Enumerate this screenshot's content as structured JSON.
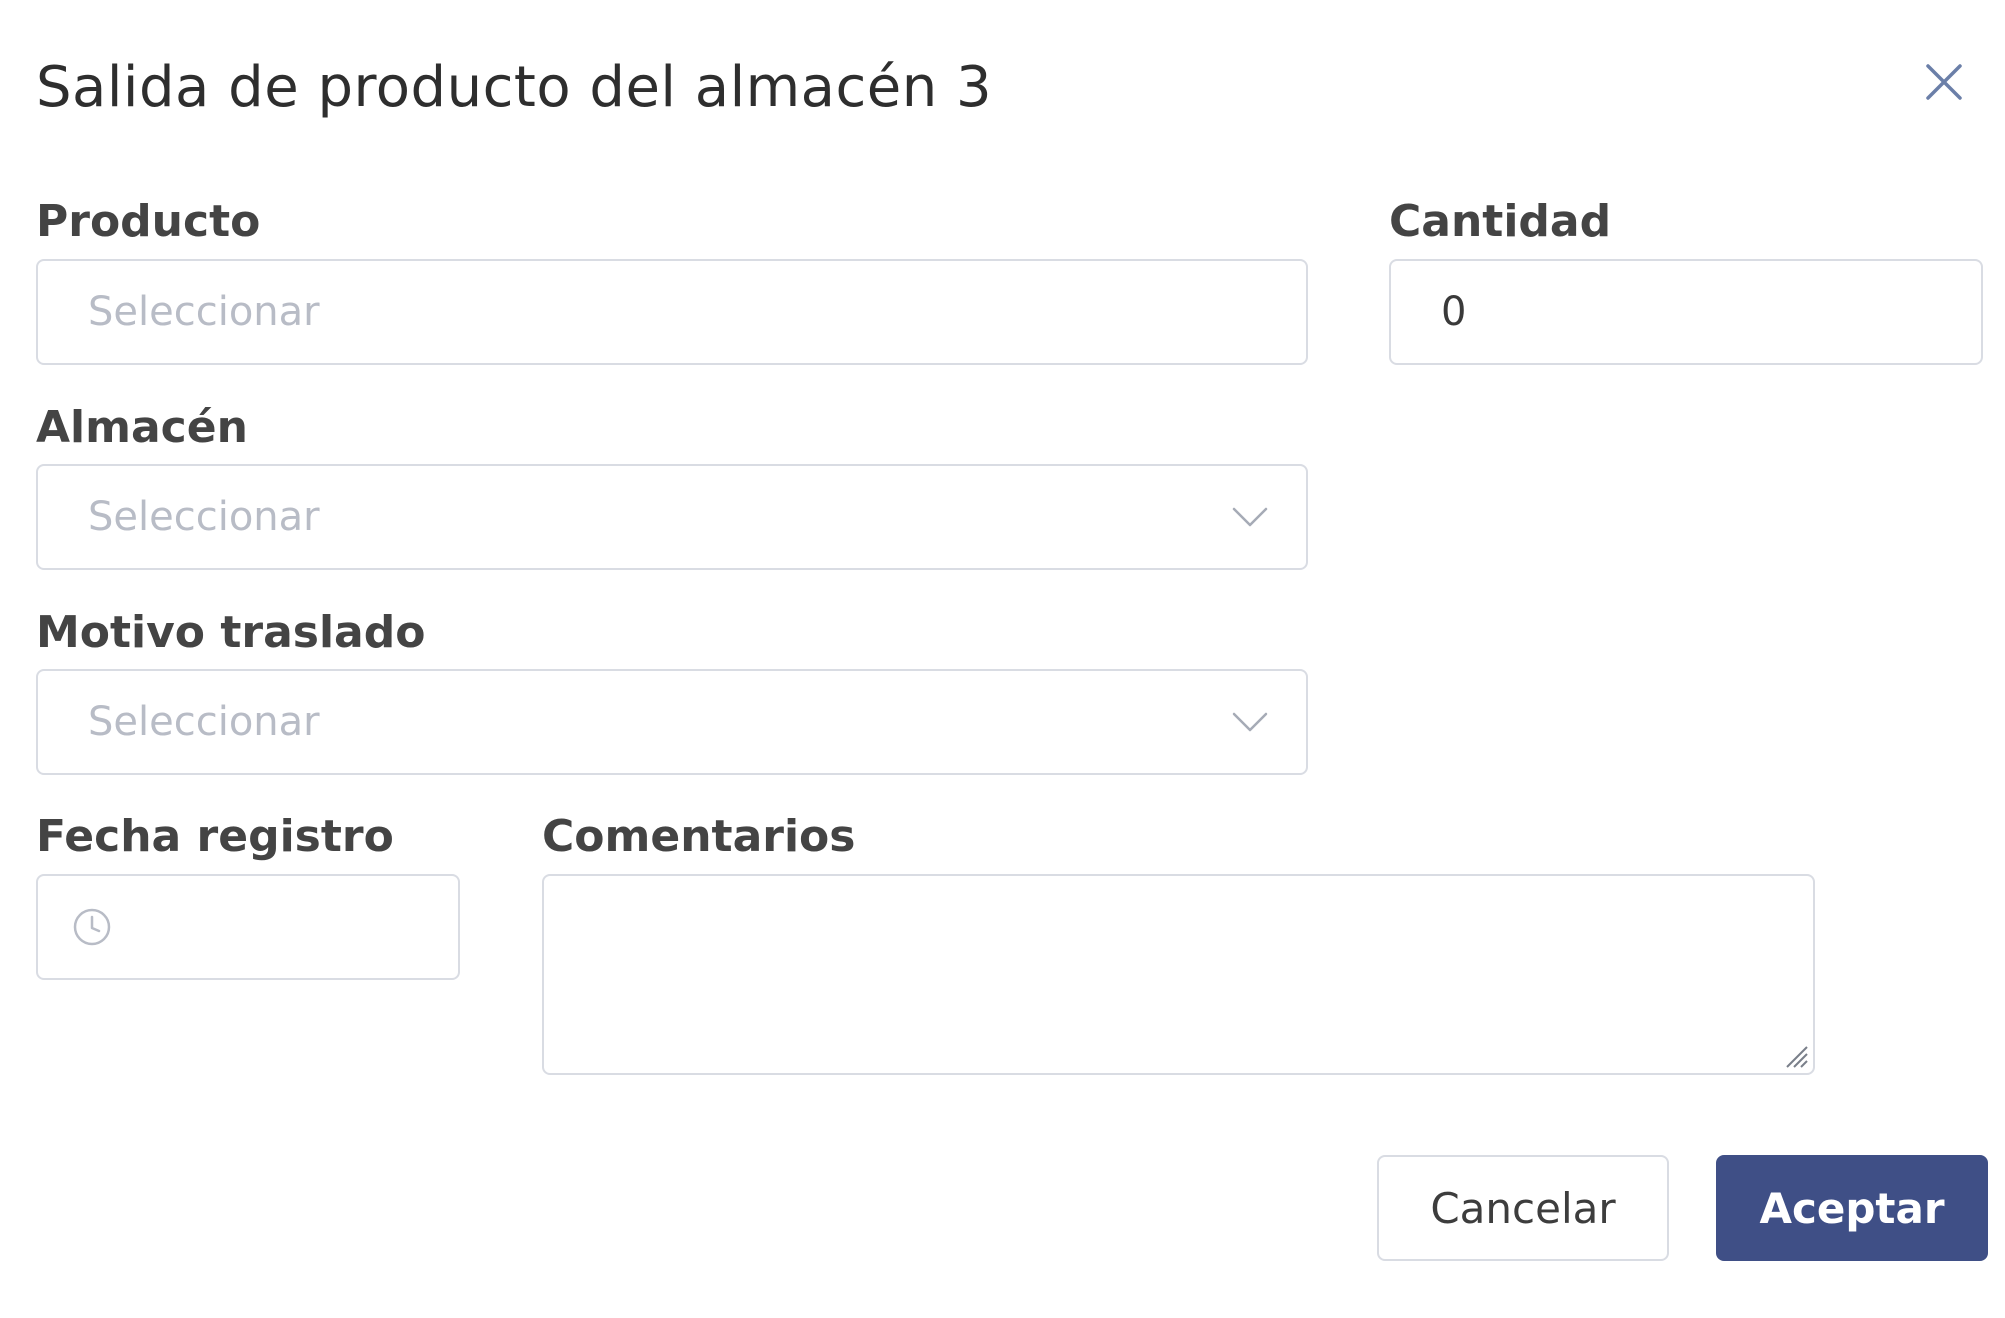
{
  "dialog": {
    "title": "Salida de producto del almacén 3",
    "close_icon": "close-icon"
  },
  "form": {
    "producto": {
      "label": "Producto",
      "placeholder": "Seleccionar"
    },
    "cantidad": {
      "label": "Cantidad",
      "value": "0"
    },
    "almacen": {
      "label": "Almacén",
      "placeholder": "Seleccionar",
      "icon": "chevron-down-icon"
    },
    "motivo": {
      "label": "Motivo traslado",
      "placeholder": "Seleccionar",
      "icon": "chevron-down-icon"
    },
    "fecha": {
      "label": "Fecha registro",
      "value": "",
      "icon": "clock-icon"
    },
    "comentarios": {
      "label": "Comentarios",
      "value": ""
    }
  },
  "actions": {
    "cancel_label": "Cancelar",
    "accept_label": "Aceptar"
  },
  "colors": {
    "accent": "#3f4f86",
    "border": "#d9dce3",
    "placeholder": "#b8bcc6"
  }
}
